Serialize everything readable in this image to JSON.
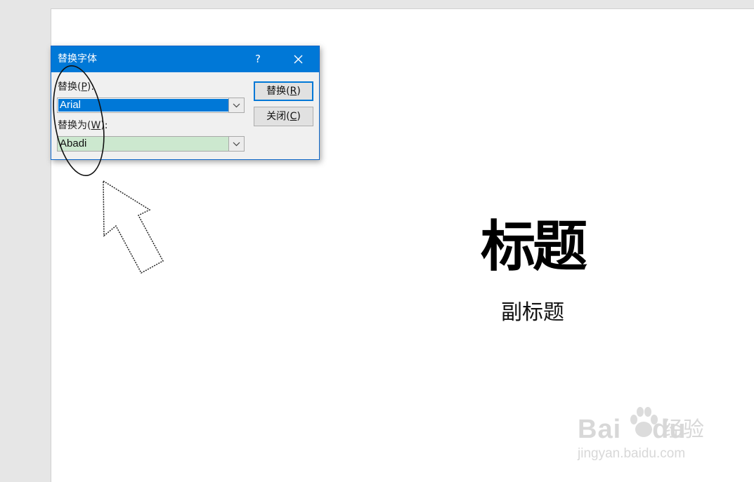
{
  "slide": {
    "title": "标题",
    "subtitle": "副标题"
  },
  "dialog": {
    "title": "替换字体",
    "help_glyph": "?",
    "replace_label": "替换(",
    "replace_hotkey": "P",
    "replace_label_end": "):",
    "replace_value": "Arial",
    "with_label": "替换为(",
    "with_hotkey": "W",
    "with_label_end": "):",
    "with_value": "Abadi",
    "replace_button": "替换(",
    "replace_button_hotkey": "R",
    "replace_button_end": ")",
    "close_button": "关闭(",
    "close_button_hotkey": "C",
    "close_button_end": ")"
  },
  "watermark": {
    "brand": "Bai",
    "brand_end": "du",
    "brand_cn": "经验",
    "url": "jingyan.baidu.com"
  },
  "colors": {
    "titlebar": "#0078d7",
    "selection": "#0078d7",
    "with_highlight": "#cce8cf"
  }
}
